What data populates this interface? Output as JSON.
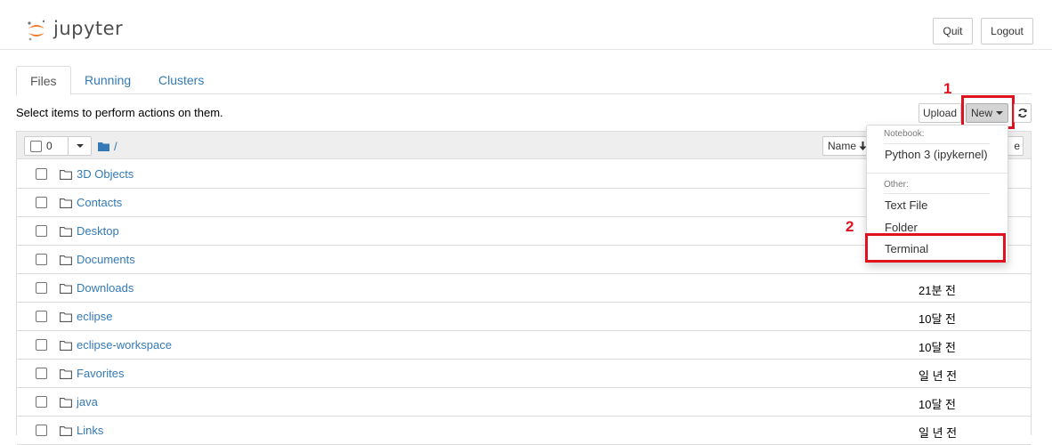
{
  "header": {
    "logo_text": "jupyter",
    "quit_label": "Quit",
    "logout_label": "Logout"
  },
  "tabs": [
    {
      "label": "Files",
      "active": true
    },
    {
      "label": "Running",
      "active": false
    },
    {
      "label": "Clusters",
      "active": false
    }
  ],
  "toolbar": {
    "info_text": "Select items to perform actions on them.",
    "upload_label": "Upload",
    "new_label": "New",
    "refresh_icon": "refresh-icon"
  },
  "list_header": {
    "selected_count": "0",
    "breadcrumb": "/",
    "sort_label": "Name",
    "modified_partial": "e"
  },
  "items": [
    {
      "name": "3D Objects",
      "modified": ""
    },
    {
      "name": "Contacts",
      "modified": ""
    },
    {
      "name": "Desktop",
      "modified": ""
    },
    {
      "name": "Documents",
      "modified": ""
    },
    {
      "name": "Downloads",
      "modified": "21분 전"
    },
    {
      "name": "eclipse",
      "modified": "10달 전"
    },
    {
      "name": "eclipse-workspace",
      "modified": "10달 전"
    },
    {
      "name": "Favorites",
      "modified": "일 년 전"
    },
    {
      "name": "java",
      "modified": "10달 전"
    },
    {
      "name": "Links",
      "modified": "일 년 전"
    }
  ],
  "new_menu": {
    "notebook_header": "Notebook:",
    "notebook_items": [
      "Python 3 (ipykernel)"
    ],
    "other_header": "Other:",
    "other_items": [
      "Text File",
      "Folder",
      "Terminal"
    ]
  },
  "annotations": {
    "step1": "1",
    "step2": "2",
    "color": "#e0121f"
  },
  "colors": {
    "link": "#337ab7",
    "logo_orange": "#f37726",
    "highlight_red": "#e0121f"
  }
}
